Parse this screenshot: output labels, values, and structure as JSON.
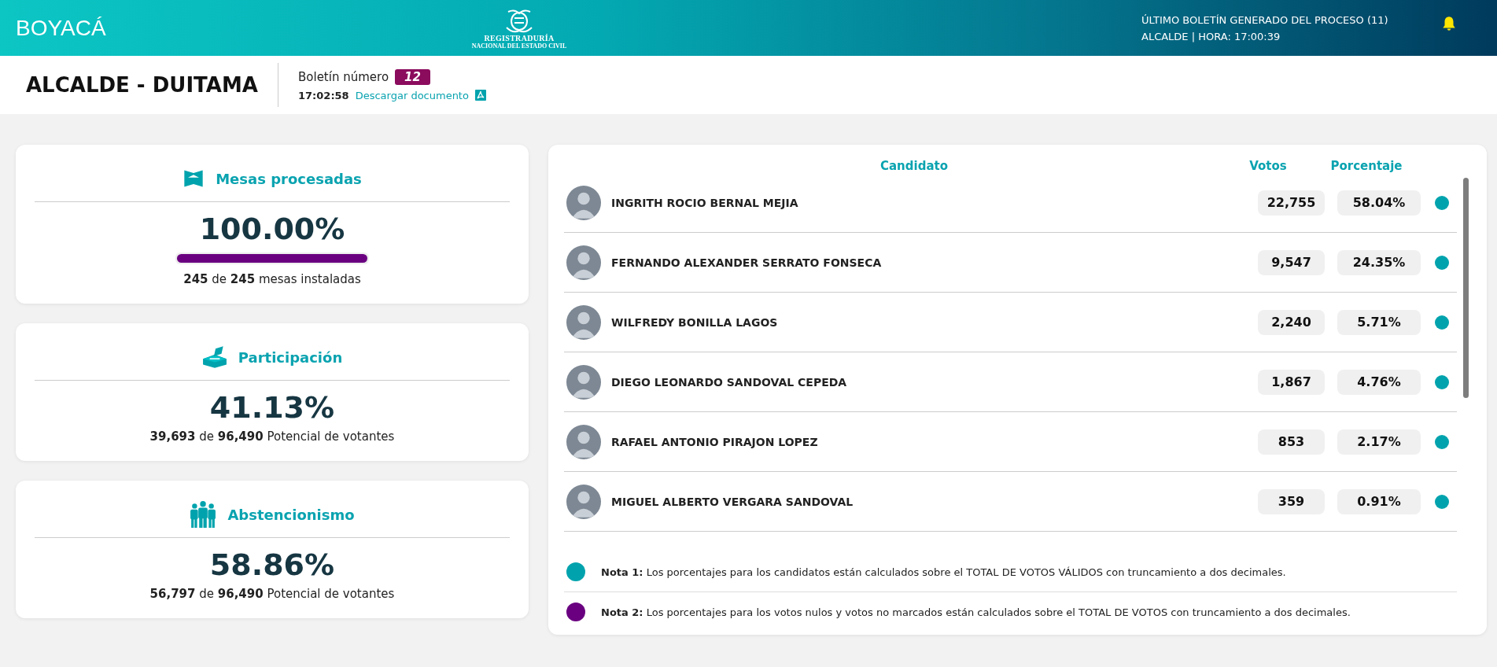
{
  "header": {
    "region": "BOYACÁ",
    "logo_lines": [
      "REGISTRADURÍA",
      "NACIONAL DEL ESTADO CIVIL"
    ],
    "last_bulletin": "ÚLTIMO BOLETÍN GENERADO DEL PROCESO (11)",
    "last_bulletin_detail": "ALCALDE | HORA: 17:00:39"
  },
  "subheader": {
    "title": "ALCALDE - DUITAMA",
    "bulletin_label": "Boletín número",
    "bulletin_number": "12",
    "time": "17:02:58",
    "download_link": "Descargar documento"
  },
  "summary_cards": [
    {
      "kind": "tables",
      "title": "Mesas procesadas",
      "value": "100.00%",
      "level": 1.0,
      "detail": "**245** de **245** mesas instaladas"
    },
    {
      "kind": "ballot",
      "title": "Participación",
      "value": "41.13%",
      "detail": "**39,693** de **96,490** Potencial de votantes"
    },
    {
      "kind": "people",
      "title": "Abstencionismo",
      "value": "58.86%",
      "detail": "**56,797** de **96,490** Potencial de votantes"
    }
  ],
  "results_table": {
    "columns": [
      "Candidato",
      "Votos",
      "Porcentaje"
    ],
    "rows": [
      {
        "name": "INGRITH ROCIO BERNAL MEJIA",
        "votes": "22,755",
        "percent": "58.04%",
        "color": "#00a3ad"
      },
      {
        "name": "FERNANDO ALEXANDER SERRATO FONSECA",
        "votes": "9,547",
        "percent": "24.35%",
        "color": "#00a3ad"
      },
      {
        "name": "WILFREDY BONILLA LAGOS",
        "votes": "2,240",
        "percent": "5.71%",
        "color": "#00a3ad"
      },
      {
        "name": "DIEGO LEONARDO SANDOVAL CEPEDA",
        "votes": "1,867",
        "percent": "4.76%",
        "color": "#00a3ad"
      },
      {
        "name": "RAFAEL ANTONIO PIRAJON LOPEZ",
        "votes": "853",
        "percent": "2.17%",
        "color": "#00a3ad"
      },
      {
        "name": "MIGUEL ALBERTO VERGARA SANDOVAL",
        "votes": "359",
        "percent": "0.91%",
        "color": "#00a3ad"
      }
    ],
    "notes": [
      {
        "text": "**Nota 1:** Los porcentajes para los candidatos están calculados sobre el TOTAL DE VOTOS VÁLIDOS con truncamiento a dos decimales.",
        "color": "#00a3ad"
      },
      {
        "text": "**Nota 2:** Los porcentajes para los votos nulos y votos no marcados están calculados sobre el TOTAL DE VOTOS con truncamiento a dos decimales.",
        "color": "#6a0080"
      }
    ]
  }
}
